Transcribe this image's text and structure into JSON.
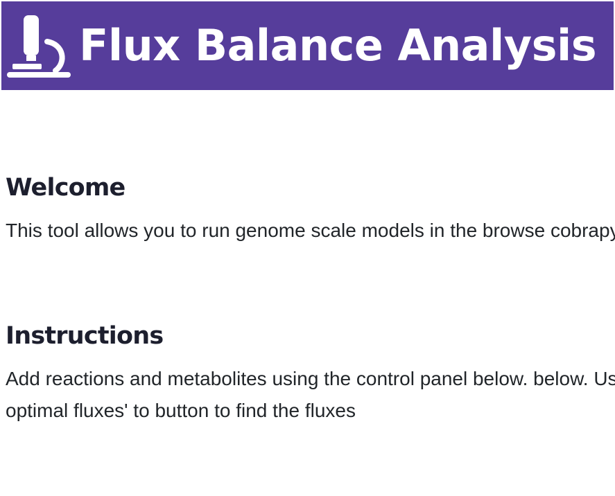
{
  "header": {
    "title": "Flux Balance Analysis",
    "icon": "microscope-icon",
    "background_color": "#563d9b",
    "text_color": "#ffffff"
  },
  "sections": {
    "welcome": {
      "heading": "Welcome",
      "text": "This tool allows you to run genome scale models in the browse cobrapy package."
    },
    "instructions": {
      "heading": "Instructions",
      "text": "Add reactions and metabolites using the control panel below. below. Use the 'find optimal fluxes' to button to find the fluxes"
    }
  }
}
